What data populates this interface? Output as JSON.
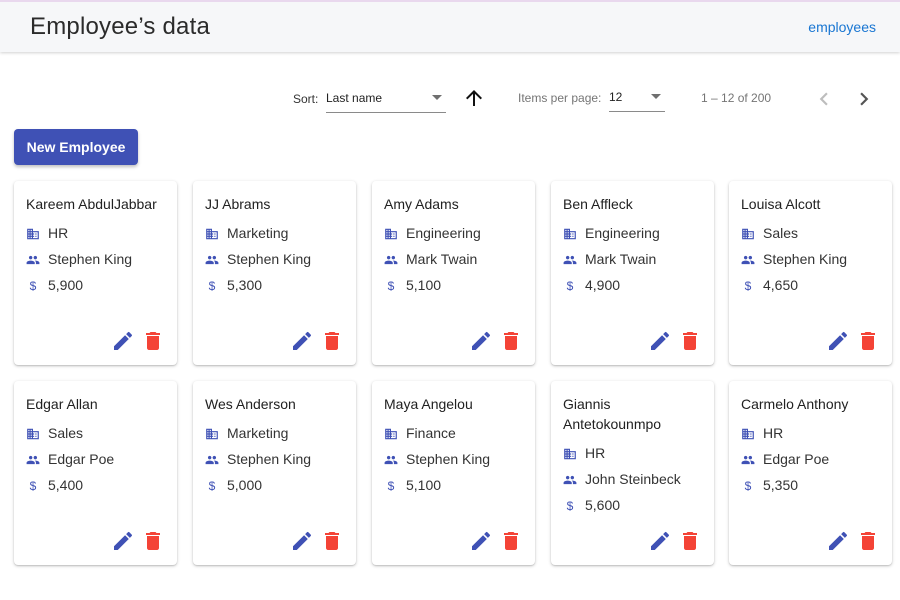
{
  "header": {
    "title": "Employee’s data",
    "nav_link": "employees"
  },
  "toolbar": {
    "sort_label": "Sort:",
    "sort_value": "Last name",
    "sort_direction_icon": "arrow-up-icon",
    "items_per_page_label": "Items per page:",
    "items_per_page_value": "12",
    "range_label": "1 – 12 of 200"
  },
  "new_employee_button": "New Employee",
  "colors": {
    "primary": "#3f51b5",
    "danger": "#f44336",
    "link": "#1976d2"
  },
  "employees": [
    {
      "name": "Kareem AbdulJabbar",
      "department": "HR",
      "manager": "Stephen King",
      "salary": "5,900"
    },
    {
      "name": "JJ Abrams",
      "department": "Marketing",
      "manager": "Stephen King",
      "salary": "5,300"
    },
    {
      "name": "Amy Adams",
      "department": "Engineering",
      "manager": "Mark Twain",
      "salary": "5,100"
    },
    {
      "name": "Ben Affleck",
      "department": "Engineering",
      "manager": "Mark Twain",
      "salary": "4,900"
    },
    {
      "name": "Louisa Alcott",
      "department": "Sales",
      "manager": "Stephen King",
      "salary": "4,650"
    },
    {
      "name": "Edgar Allan",
      "department": "Sales",
      "manager": "Edgar Poe",
      "salary": "5,400"
    },
    {
      "name": "Wes Anderson",
      "department": "Marketing",
      "manager": "Stephen King",
      "salary": "5,000"
    },
    {
      "name": "Maya Angelou",
      "department": "Finance",
      "manager": "Stephen King",
      "salary": "5,100"
    },
    {
      "name": "Giannis Antetokounmpo",
      "department": "HR",
      "manager": "John Steinbeck",
      "salary": "5,600"
    },
    {
      "name": "Carmelo Anthony",
      "department": "HR",
      "manager": "Edgar Poe",
      "salary": "5,350"
    }
  ]
}
